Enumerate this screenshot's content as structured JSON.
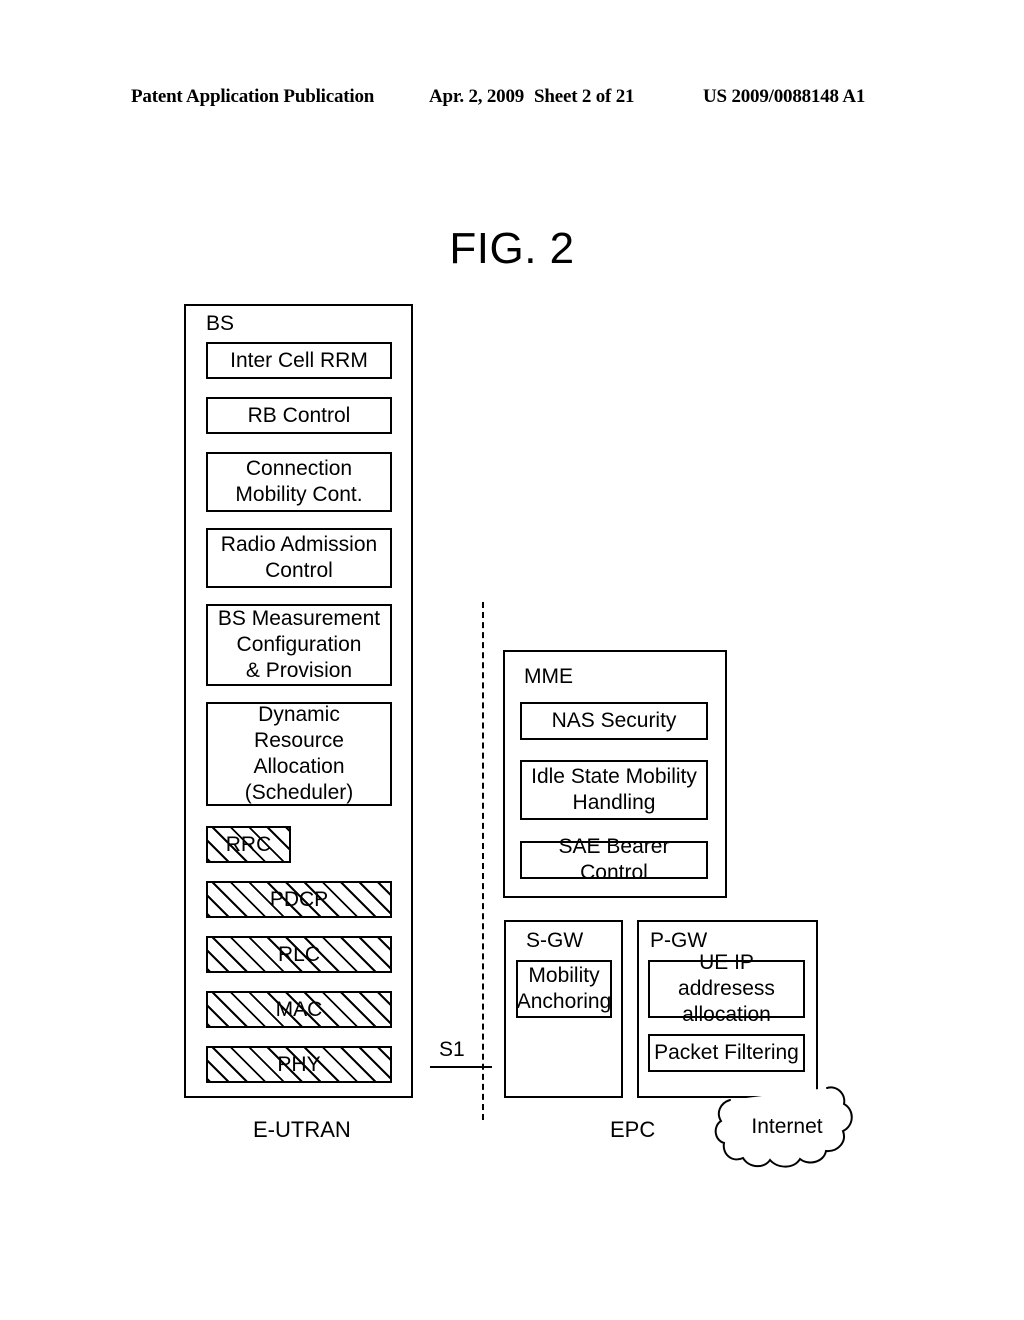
{
  "header": {
    "publication": "Patent Application Publication",
    "date": "Apr. 2, 2009",
    "sheet": "Sheet 2 of 21",
    "number": "US 2009/0088148 A1"
  },
  "figure": {
    "title": "FIG. 2"
  },
  "bs": {
    "label": "BS",
    "functions": [
      {
        "label": "Inter Cell RRM"
      },
      {
        "label": "RB Control"
      },
      {
        "label": "Connection\nMobility Cont."
      },
      {
        "label": "Radio Admission\nControl"
      },
      {
        "label": "BS Measurement\nConfiguration\n& Provision"
      },
      {
        "label": "Dynamic Resource\nAllocation\n(Scheduler)"
      }
    ],
    "protocol_stack": [
      {
        "label": "RRC"
      },
      {
        "label": "PDCP"
      },
      {
        "label": "RLC"
      },
      {
        "label": "MAC"
      },
      {
        "label": "PHY"
      }
    ]
  },
  "mme": {
    "label": "MME",
    "functions": [
      {
        "label": "NAS Security"
      },
      {
        "label": "Idle State Mobility\nHandling"
      },
      {
        "label": "SAE Bearer Control"
      }
    ]
  },
  "sgw": {
    "label": "S-GW",
    "functions": [
      {
        "label": "Mobility\nAnchoring"
      }
    ]
  },
  "pgw": {
    "label": "P-GW",
    "functions": [
      {
        "label": "UE IP addresess\nallocation"
      },
      {
        "label": "Packet Filtering"
      }
    ]
  },
  "interface": {
    "s1_label": "S1"
  },
  "captions": {
    "left": "E-UTRAN",
    "right": "EPC"
  },
  "cloud": {
    "label": "Internet"
  }
}
